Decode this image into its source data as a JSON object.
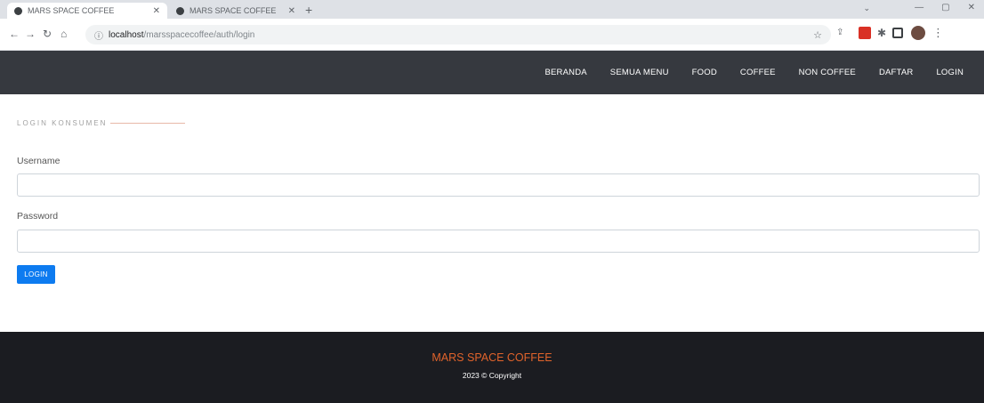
{
  "browser": {
    "tabs": [
      {
        "title": "MARS SPACE COFFEE",
        "active": true
      },
      {
        "title": "MARS SPACE COFFEE",
        "active": false
      }
    ],
    "address": {
      "host": "localhost",
      "path": "/marsspacecoffee/auth/login"
    }
  },
  "nav": {
    "items": [
      "BERANDA",
      "SEMUA MENU",
      "FOOD",
      "COFFEE",
      "NON COFFEE",
      "DAFTAR",
      "LOGIN"
    ]
  },
  "login": {
    "section_title": "LOGIN KONSUMEN",
    "username_label": "Username",
    "username_value": "",
    "password_label": "Password",
    "password_value": "",
    "submit_label": "LOGIN"
  },
  "footer": {
    "brand": "MARS SPACE COFFEE",
    "copyright": "2023 © Copyright"
  },
  "colors": {
    "navbar_bg": "#36393f",
    "footer_bg": "#1b1c21",
    "brand_accent": "#e0632b",
    "button_primary": "#0d7bf0"
  }
}
